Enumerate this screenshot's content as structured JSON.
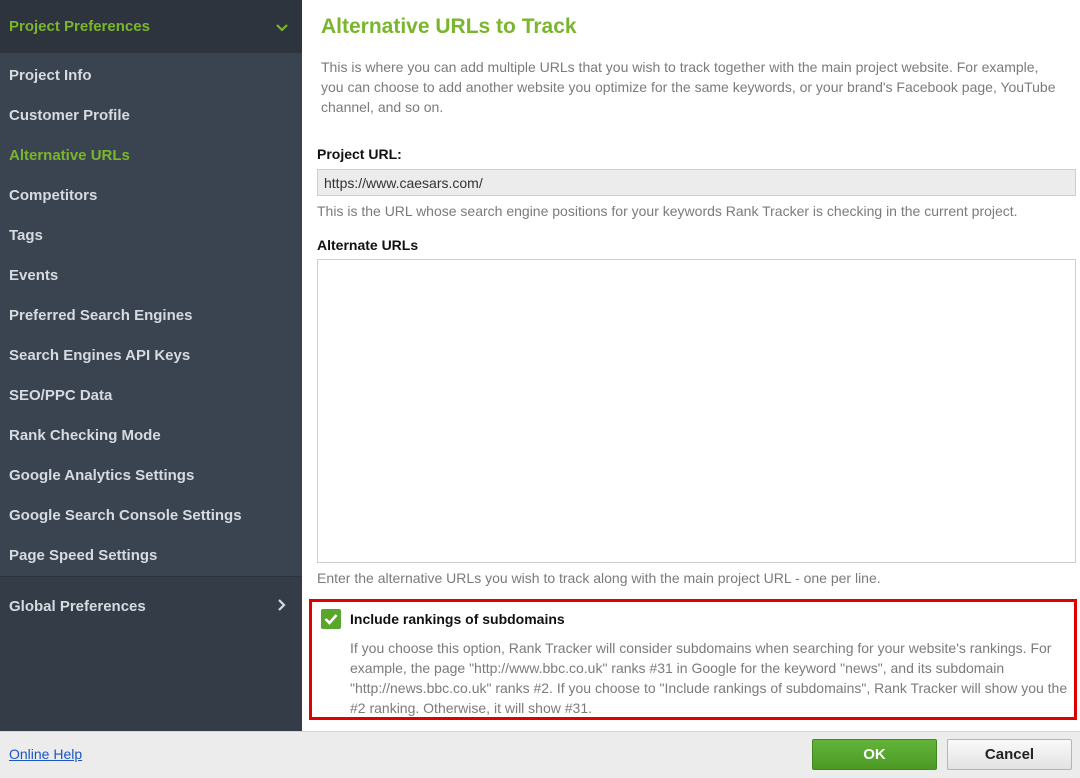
{
  "sidebar": {
    "header": "Project Preferences",
    "items": [
      {
        "label": "Project Info"
      },
      {
        "label": "Customer Profile"
      },
      {
        "label": "Alternative URLs"
      },
      {
        "label": "Competitors"
      },
      {
        "label": "Tags"
      },
      {
        "label": "Events"
      },
      {
        "label": "Preferred Search Engines"
      },
      {
        "label": "Search Engines API Keys"
      },
      {
        "label": "SEO/PPC Data"
      },
      {
        "label": "Rank Checking Mode"
      },
      {
        "label": "Google Analytics Settings"
      },
      {
        "label": "Google Search Console Settings"
      },
      {
        "label": "Page Speed Settings"
      }
    ],
    "active_item": "Alternative URLs",
    "global": "Global Preferences"
  },
  "main": {
    "title": "Alternative URLs to Track",
    "description": "This is where you can add multiple URLs that you wish to track together with the main project website. For example, you can choose to add another website you optimize for the same keywords, or your brand's Facebook page, YouTube channel, and so on.",
    "project_url_label": "Project URL:",
    "project_url_value": "https://www.caesars.com/",
    "project_url_hint": "This is the URL whose search engine positions for your keywords Rank Tracker is checking in the current project.",
    "alternate_label": "Alternate URLs",
    "alternate_value": "",
    "alternate_hint": "Enter the alternative URLs you wish to track along with the main project URL - one per line.",
    "subdomains": {
      "checked": true,
      "label": "Include rankings of subdomains",
      "description": "If you choose this option, Rank Tracker will consider subdomains when searching for your website's rankings. For example, the page \"http://www.bbc.co.uk\" ranks #31 in Google for the keyword \"news\", and its subdomain \"http://news.bbc.co.uk\" ranks #2. If you choose to \"Include rankings of subdomains\", Rank Tracker will show you the #2 ranking. Otherwise, it will show #31."
    }
  },
  "footer": {
    "help_link": "Online Help",
    "ok_label": "OK",
    "cancel_label": "Cancel"
  },
  "colors": {
    "accent": "#7ab62d",
    "sidebar_bg": "#3a4350",
    "highlight_border": "#e00000",
    "ok_button": "#54a22b"
  }
}
